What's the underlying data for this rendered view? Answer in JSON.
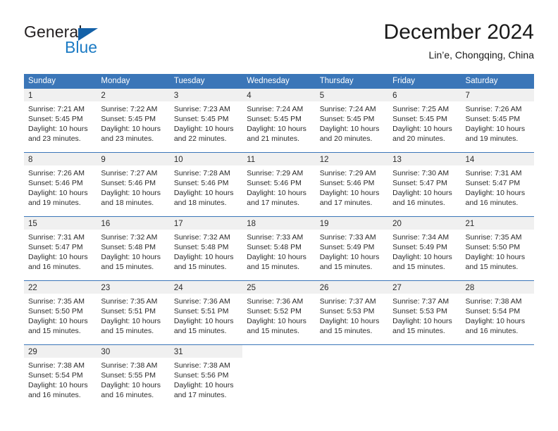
{
  "brand": {
    "name_top": "General",
    "name_bottom": "Blue",
    "triangle_color": "#1461a8",
    "blue_color": "#1c7bc4"
  },
  "header": {
    "title": "December 2024",
    "subtitle": "Lin’e, Chongqing, China"
  },
  "theme": {
    "header_blue": "#3b76b8",
    "day_band_gray": "#f0f0f0",
    "text": "#2b2b2b"
  },
  "weekdays": [
    "Sunday",
    "Monday",
    "Tuesday",
    "Wednesday",
    "Thursday",
    "Friday",
    "Saturday"
  ],
  "weeks": [
    [
      {
        "day": "1",
        "lines": [
          "Sunrise: 7:21 AM",
          "Sunset: 5:45 PM",
          "Daylight: 10 hours",
          "and 23 minutes."
        ]
      },
      {
        "day": "2",
        "lines": [
          "Sunrise: 7:22 AM",
          "Sunset: 5:45 PM",
          "Daylight: 10 hours",
          "and 23 minutes."
        ]
      },
      {
        "day": "3",
        "lines": [
          "Sunrise: 7:23 AM",
          "Sunset: 5:45 PM",
          "Daylight: 10 hours",
          "and 22 minutes."
        ]
      },
      {
        "day": "4",
        "lines": [
          "Sunrise: 7:24 AM",
          "Sunset: 5:45 PM",
          "Daylight: 10 hours",
          "and 21 minutes."
        ]
      },
      {
        "day": "5",
        "lines": [
          "Sunrise: 7:24 AM",
          "Sunset: 5:45 PM",
          "Daylight: 10 hours",
          "and 20 minutes."
        ]
      },
      {
        "day": "6",
        "lines": [
          "Sunrise: 7:25 AM",
          "Sunset: 5:45 PM",
          "Daylight: 10 hours",
          "and 20 minutes."
        ]
      },
      {
        "day": "7",
        "lines": [
          "Sunrise: 7:26 AM",
          "Sunset: 5:45 PM",
          "Daylight: 10 hours",
          "and 19 minutes."
        ]
      }
    ],
    [
      {
        "day": "8",
        "lines": [
          "Sunrise: 7:26 AM",
          "Sunset: 5:46 PM",
          "Daylight: 10 hours",
          "and 19 minutes."
        ]
      },
      {
        "day": "9",
        "lines": [
          "Sunrise: 7:27 AM",
          "Sunset: 5:46 PM",
          "Daylight: 10 hours",
          "and 18 minutes."
        ]
      },
      {
        "day": "10",
        "lines": [
          "Sunrise: 7:28 AM",
          "Sunset: 5:46 PM",
          "Daylight: 10 hours",
          "and 18 minutes."
        ]
      },
      {
        "day": "11",
        "lines": [
          "Sunrise: 7:29 AM",
          "Sunset: 5:46 PM",
          "Daylight: 10 hours",
          "and 17 minutes."
        ]
      },
      {
        "day": "12",
        "lines": [
          "Sunrise: 7:29 AM",
          "Sunset: 5:46 PM",
          "Daylight: 10 hours",
          "and 17 minutes."
        ]
      },
      {
        "day": "13",
        "lines": [
          "Sunrise: 7:30 AM",
          "Sunset: 5:47 PM",
          "Daylight: 10 hours",
          "and 16 minutes."
        ]
      },
      {
        "day": "14",
        "lines": [
          "Sunrise: 7:31 AM",
          "Sunset: 5:47 PM",
          "Daylight: 10 hours",
          "and 16 minutes."
        ]
      }
    ],
    [
      {
        "day": "15",
        "lines": [
          "Sunrise: 7:31 AM",
          "Sunset: 5:47 PM",
          "Daylight: 10 hours",
          "and 16 minutes."
        ]
      },
      {
        "day": "16",
        "lines": [
          "Sunrise: 7:32 AM",
          "Sunset: 5:48 PM",
          "Daylight: 10 hours",
          "and 15 minutes."
        ]
      },
      {
        "day": "17",
        "lines": [
          "Sunrise: 7:32 AM",
          "Sunset: 5:48 PM",
          "Daylight: 10 hours",
          "and 15 minutes."
        ]
      },
      {
        "day": "18",
        "lines": [
          "Sunrise: 7:33 AM",
          "Sunset: 5:48 PM",
          "Daylight: 10 hours",
          "and 15 minutes."
        ]
      },
      {
        "day": "19",
        "lines": [
          "Sunrise: 7:33 AM",
          "Sunset: 5:49 PM",
          "Daylight: 10 hours",
          "and 15 minutes."
        ]
      },
      {
        "day": "20",
        "lines": [
          "Sunrise: 7:34 AM",
          "Sunset: 5:49 PM",
          "Daylight: 10 hours",
          "and 15 minutes."
        ]
      },
      {
        "day": "21",
        "lines": [
          "Sunrise: 7:35 AM",
          "Sunset: 5:50 PM",
          "Daylight: 10 hours",
          "and 15 minutes."
        ]
      }
    ],
    [
      {
        "day": "22",
        "lines": [
          "Sunrise: 7:35 AM",
          "Sunset: 5:50 PM",
          "Daylight: 10 hours",
          "and 15 minutes."
        ]
      },
      {
        "day": "23",
        "lines": [
          "Sunrise: 7:35 AM",
          "Sunset: 5:51 PM",
          "Daylight: 10 hours",
          "and 15 minutes."
        ]
      },
      {
        "day": "24",
        "lines": [
          "Sunrise: 7:36 AM",
          "Sunset: 5:51 PM",
          "Daylight: 10 hours",
          "and 15 minutes."
        ]
      },
      {
        "day": "25",
        "lines": [
          "Sunrise: 7:36 AM",
          "Sunset: 5:52 PM",
          "Daylight: 10 hours",
          "and 15 minutes."
        ]
      },
      {
        "day": "26",
        "lines": [
          "Sunrise: 7:37 AM",
          "Sunset: 5:53 PM",
          "Daylight: 10 hours",
          "and 15 minutes."
        ]
      },
      {
        "day": "27",
        "lines": [
          "Sunrise: 7:37 AM",
          "Sunset: 5:53 PM",
          "Daylight: 10 hours",
          "and 15 minutes."
        ]
      },
      {
        "day": "28",
        "lines": [
          "Sunrise: 7:38 AM",
          "Sunset: 5:54 PM",
          "Daylight: 10 hours",
          "and 16 minutes."
        ]
      }
    ],
    [
      {
        "day": "29",
        "lines": [
          "Sunrise: 7:38 AM",
          "Sunset: 5:54 PM",
          "Daylight: 10 hours",
          "and 16 minutes."
        ]
      },
      {
        "day": "30",
        "lines": [
          "Sunrise: 7:38 AM",
          "Sunset: 5:55 PM",
          "Daylight: 10 hours",
          "and 16 minutes."
        ]
      },
      {
        "day": "31",
        "lines": [
          "Sunrise: 7:38 AM",
          "Sunset: 5:56 PM",
          "Daylight: 10 hours",
          "and 17 minutes."
        ]
      },
      {
        "day": "",
        "lines": []
      },
      {
        "day": "",
        "lines": []
      },
      {
        "day": "",
        "lines": []
      },
      {
        "day": "",
        "lines": []
      }
    ]
  ]
}
